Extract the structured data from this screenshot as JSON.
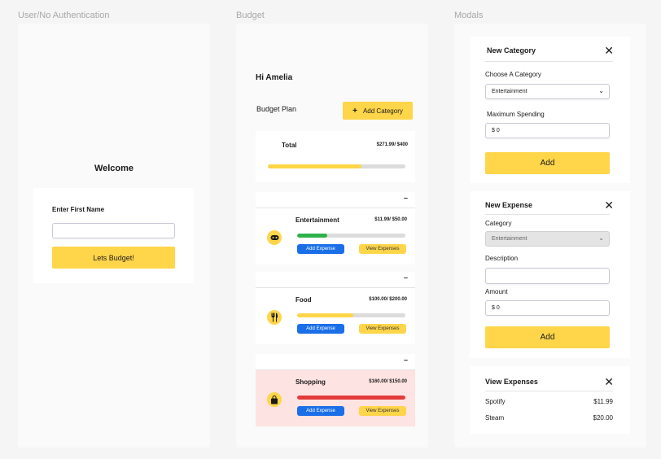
{
  "frames": {
    "auth_label": "User/No Authentication",
    "budget_label": "Budget",
    "modals_label": "Modals"
  },
  "auth": {
    "welcome": "Welcome",
    "first_name_label": "Enter First Name",
    "first_name_value": "",
    "submit_label": "Lets Budget!"
  },
  "budget": {
    "greeting": "Hi Amelia",
    "plan_title": "Budget Plan",
    "add_category_label": "Add Category",
    "add_icon_glyph": "+",
    "total": {
      "label": "Total",
      "amount": "$271.99/ $400",
      "progress": 0.68,
      "color": "#ffd54a"
    },
    "collapse_glyph": "–",
    "categories": [
      {
        "name": "Entertainment",
        "amount": "$11.99/ $50.00",
        "progress": 0.28,
        "color": "#2fb24c",
        "icon": "gamepad-icon",
        "alert": false,
        "add_label": "Add Expense",
        "view_label": "View Expenses"
      },
      {
        "name": "Food",
        "amount": "$100.00/ $200.00",
        "progress": 0.52,
        "color": "#ffd54a",
        "icon": "utensils-icon",
        "alert": false,
        "add_label": "Add Expense",
        "view_label": "View Expenses"
      },
      {
        "name": "Shopping",
        "amount": "$160.00/ $150.00",
        "progress": 1.0,
        "color": "#e33b3b",
        "icon": "shopping-bag-icon",
        "alert": true,
        "add_label": "Add Expense",
        "view_label": "View Expenses"
      }
    ]
  },
  "modals": {
    "close_glyph": "✕",
    "new_category": {
      "title": "New Category",
      "choose_label": "Choose A Category",
      "choose_value": "Entertainment",
      "max_label": "Maximum Spending",
      "max_value": "$ 0",
      "add_label": "Add"
    },
    "new_expense": {
      "title": "New Expense",
      "category_label": "Category",
      "category_value": "Entertainment",
      "description_label": "Description",
      "description_value": "",
      "amount_label": "Amount",
      "amount_value": "$ 0",
      "add_label": "Add"
    },
    "view_expenses": {
      "title": "View Expenses",
      "items": [
        {
          "name": "Spotify",
          "amount": "$11.99"
        },
        {
          "name": "Steam",
          "amount": "$20.00"
        }
      ]
    }
  },
  "colors": {
    "accent_yellow": "#ffd54a",
    "primary_blue": "#1a6fe8",
    "alert_bg": "#fde3e1",
    "over_budget_red": "#e33b3b",
    "ok_green": "#2fb24c"
  }
}
